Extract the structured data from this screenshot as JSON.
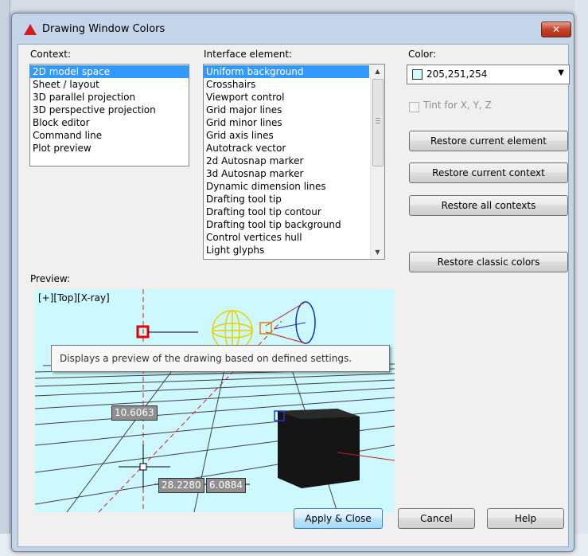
{
  "dialog": {
    "title": "Drawing Window Colors",
    "close_glyph": "✕"
  },
  "context": {
    "label": "Context:",
    "items": [
      {
        "label": "2D model space",
        "selected": true
      },
      {
        "label": "Sheet / layout"
      },
      {
        "label": "3D parallel projection"
      },
      {
        "label": "3D perspective projection"
      },
      {
        "label": "Block editor"
      },
      {
        "label": "Command line"
      },
      {
        "label": "Plot preview"
      }
    ]
  },
  "interface": {
    "label": "Interface element:",
    "items": [
      {
        "label": "Uniform background",
        "selected": true
      },
      {
        "label": "Crosshairs"
      },
      {
        "label": "Viewport control"
      },
      {
        "label": "Grid major lines"
      },
      {
        "label": "Grid minor lines"
      },
      {
        "label": "Grid axis lines"
      },
      {
        "label": "Autotrack vector"
      },
      {
        "label": "2d Autosnap marker"
      },
      {
        "label": "3d Autosnap marker"
      },
      {
        "label": "Dynamic dimension lines"
      },
      {
        "label": "Drafting tool tip"
      },
      {
        "label": "Drafting tool tip contour"
      },
      {
        "label": "Drafting tool tip background"
      },
      {
        "label": "Control vertices hull"
      },
      {
        "label": "Light glyphs"
      }
    ]
  },
  "color": {
    "label": "Color:",
    "value": "205,251,254",
    "swatch": "#cdfbfe",
    "tint_label": "Tint for X, Y, Z",
    "tint_checked": false
  },
  "buttons": {
    "restore_element": "Restore current element",
    "restore_context": "Restore current context",
    "restore_all": "Restore all contexts",
    "restore_classic": "Restore classic colors",
    "apply_close": "Apply & Close",
    "cancel": "Cancel",
    "help": "Help"
  },
  "preview": {
    "label": "Preview:",
    "viewport_label": "[+][Top][X-ray]",
    "dim1": "10.6063",
    "dim2": "28.2280",
    "dim3": "6.0884",
    "tooltip": "Displays a preview of the drawing based on defined settings."
  }
}
